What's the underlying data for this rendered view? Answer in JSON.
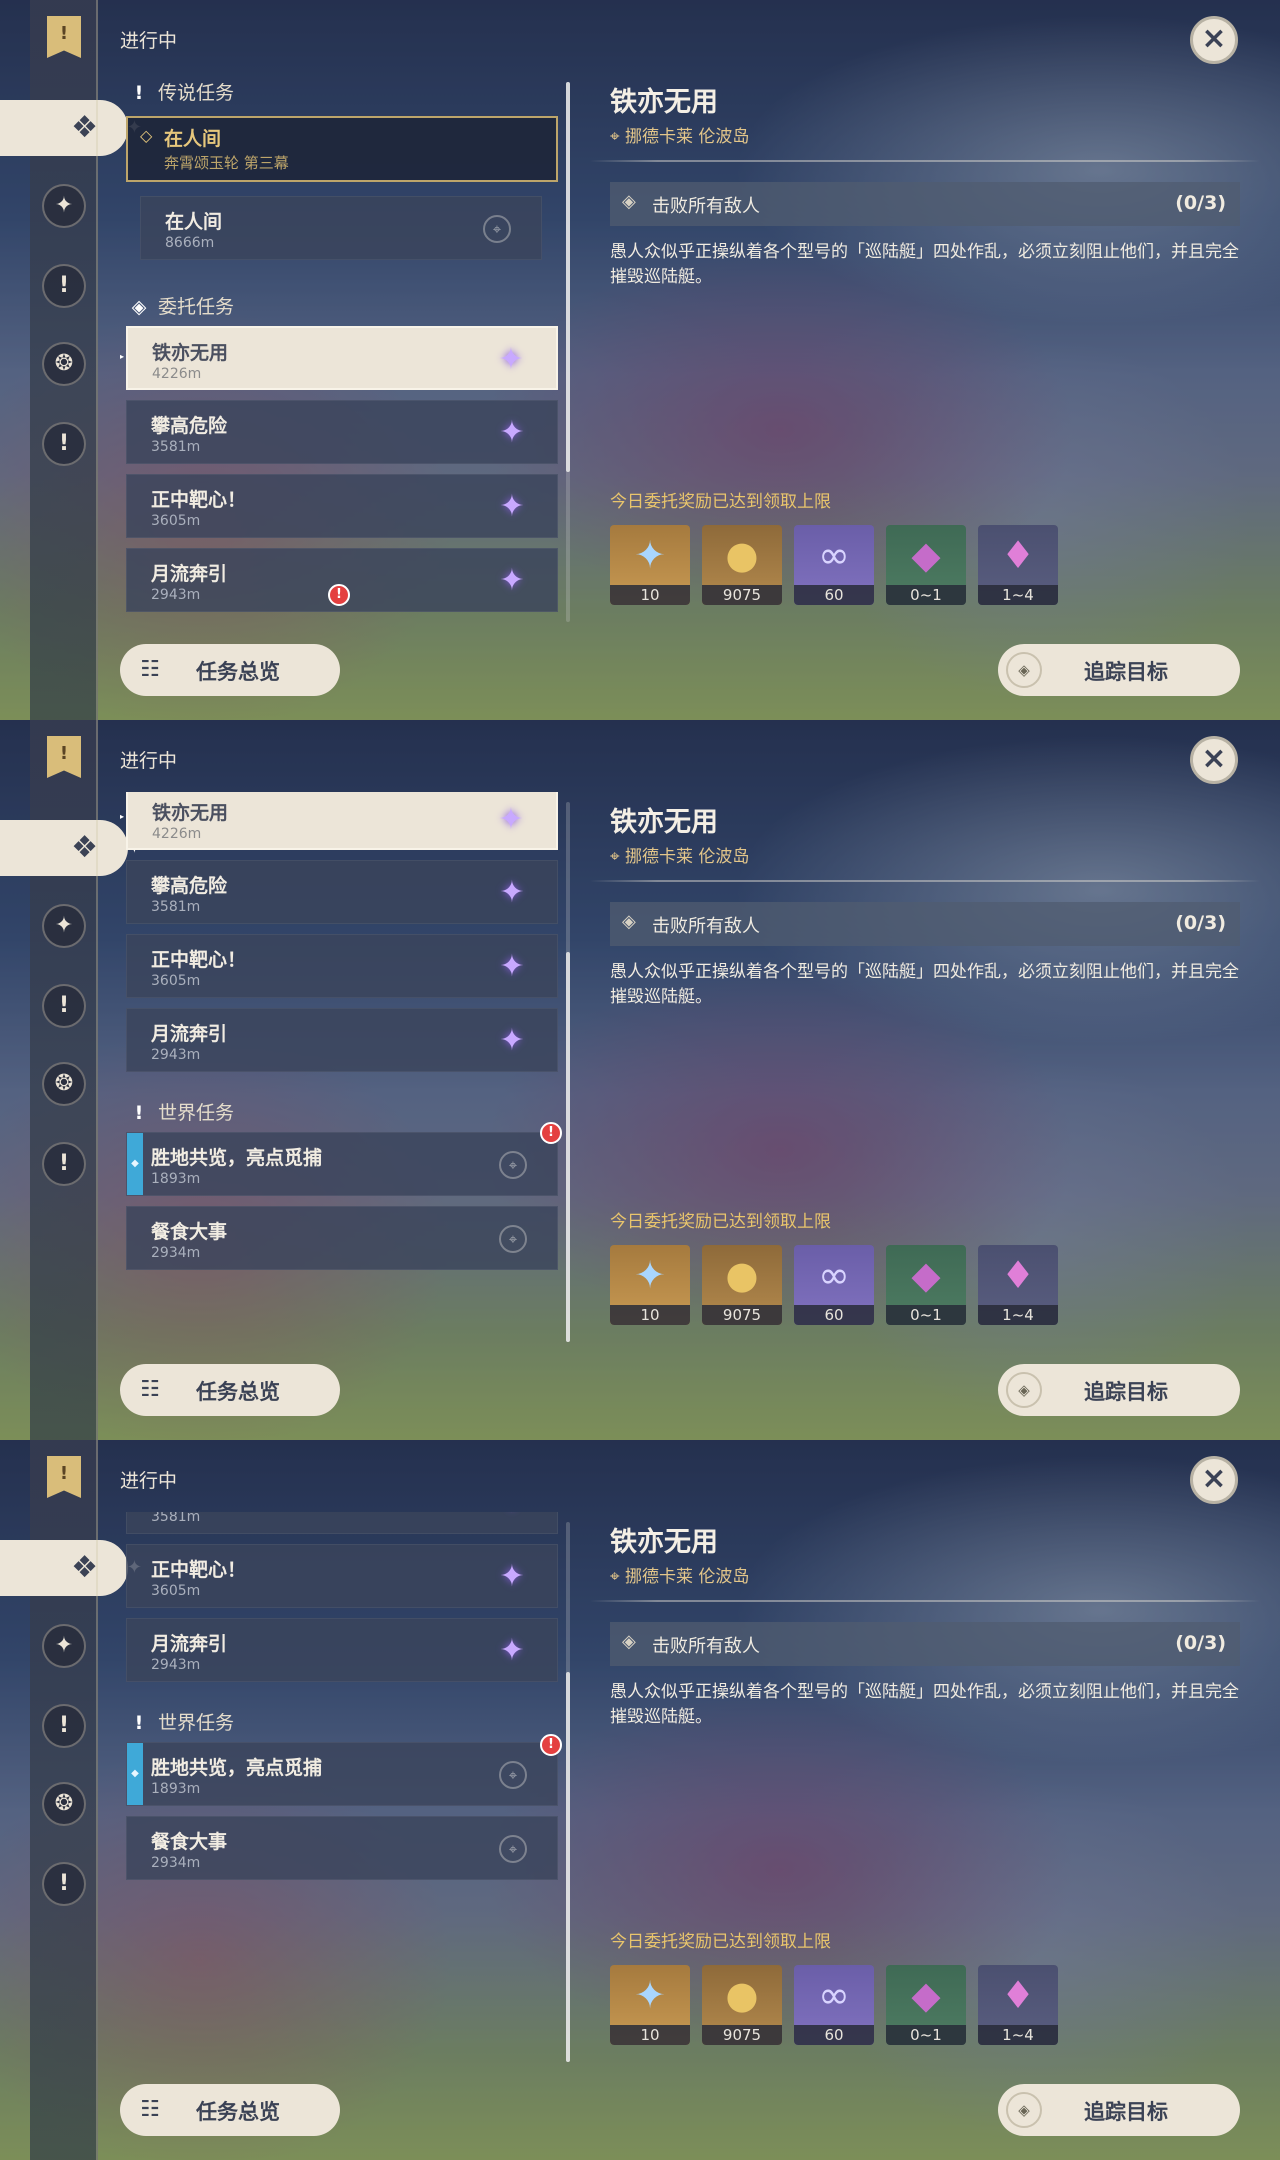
{
  "header": {
    "status": "进行中",
    "close_icon": "×"
  },
  "sidebar": {
    "icons": [
      "quest-book-icon",
      "commission-icon",
      "story-icon",
      "world-icon",
      "event-icon",
      "alert-icon"
    ],
    "glyphs": {
      "flag": "!",
      "active": "❖",
      "story": "✦",
      "world": "!",
      "event": "❂",
      "alert": "!"
    }
  },
  "sections": {
    "legend": "传说任务",
    "commission": "委托任务",
    "world": "世界任务"
  },
  "quests": {
    "legend_main": {
      "title": "在人间",
      "subtitle": "奔霄颂玉轮 第三幕"
    },
    "legend_step": {
      "title": "在人间",
      "distance": "8666m"
    },
    "commissions": [
      {
        "title": "铁亦无用",
        "distance": "4226m"
      },
      {
        "title": "攀高危险",
        "distance": "3581m"
      },
      {
        "title": "正中靶心！",
        "distance": "3605m"
      },
      {
        "title": "月流奔引",
        "distance": "2943m"
      }
    ],
    "world": [
      {
        "title": "胜地共览，亮点觅捕",
        "distance": "1893m"
      },
      {
        "title": "餐食大事",
        "distance": "2934m"
      }
    ]
  },
  "detail": {
    "title": "铁亦无用",
    "location": "挪德卡莱 伦波岛",
    "objective": "击败所有敌人",
    "progress": "(0/3)",
    "description": "愚人众似乎正操纵着各个型号的「巡陆艇」四处作乱，必须立刻阻止他们，并且完全摧毁巡陆艇。",
    "reward_note": "今日委托奖励已达到领取上限",
    "rewards": [
      {
        "icon": "adventure-exp-icon",
        "count": "10"
      },
      {
        "icon": "mora-icon",
        "count": "9075"
      },
      {
        "icon": "friendship-exp-icon",
        "count": "60"
      },
      {
        "icon": "crystal-ore-icon",
        "count": "0~1"
      },
      {
        "icon": "crystal-cluster-icon",
        "count": "1~4"
      }
    ]
  },
  "buttons": {
    "overview": "任务总览",
    "track": "追踪目标"
  },
  "scroll": {
    "panel_1": 0.0,
    "panel_2": 0.35,
    "panel_3": 1.0
  }
}
